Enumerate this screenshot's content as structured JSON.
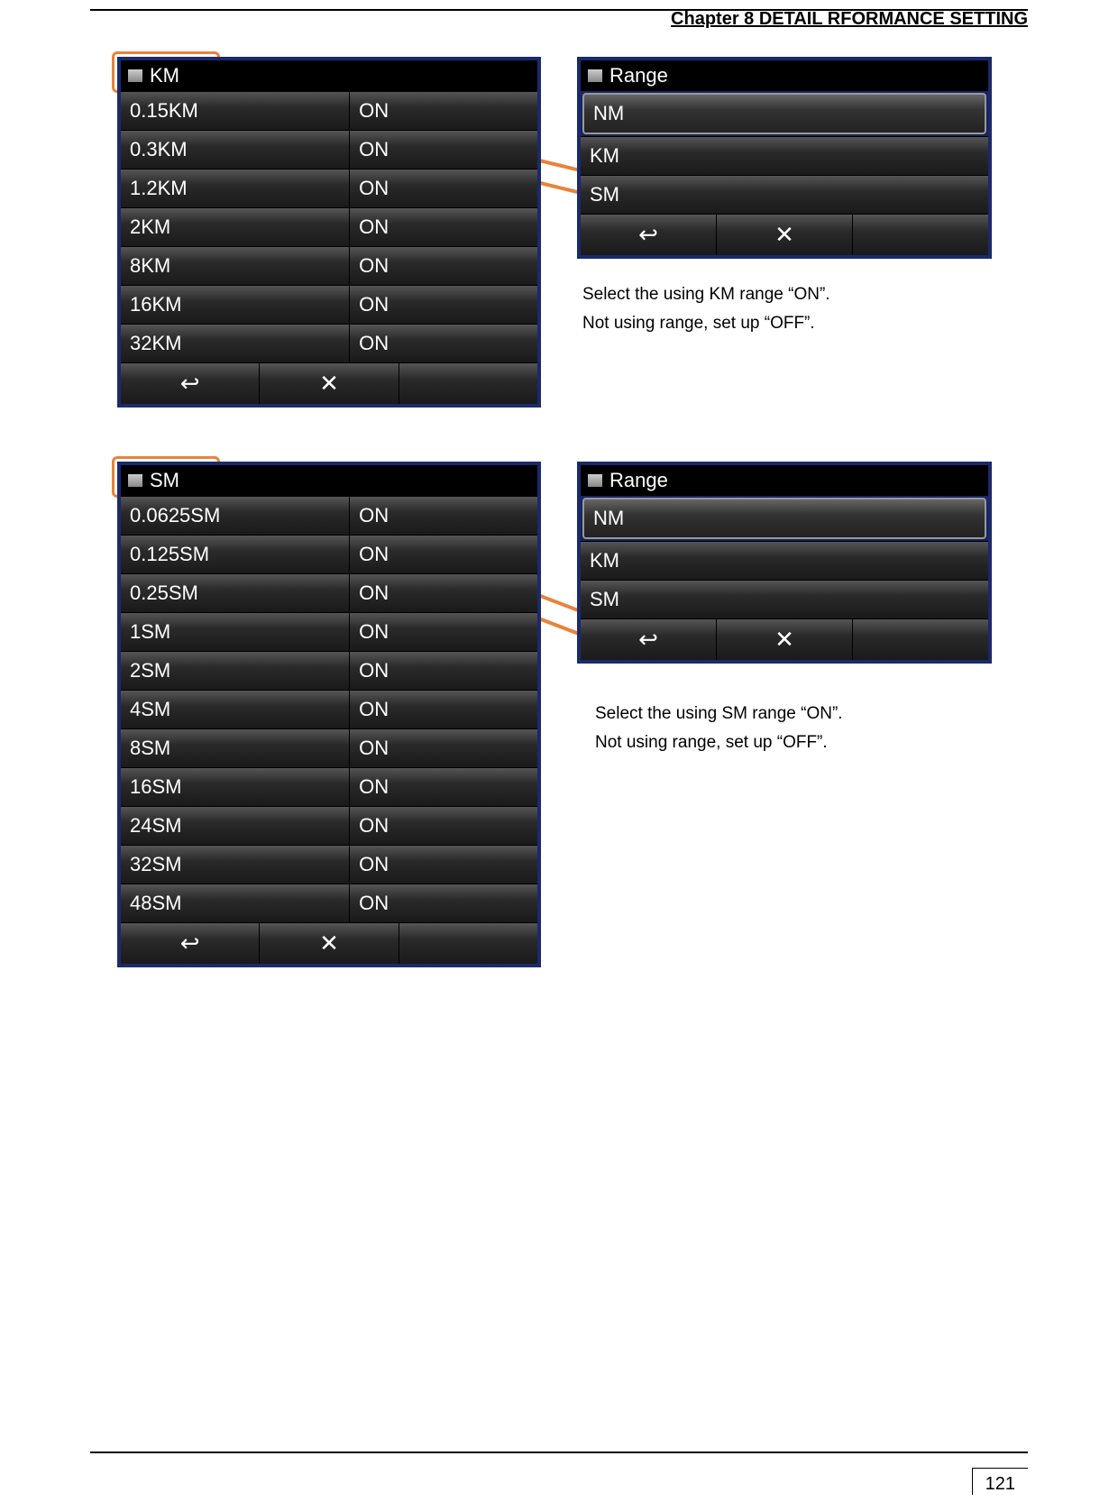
{
  "header": {
    "chapter": "Chapter 8    DETAIL RFORMANCE SETTING"
  },
  "footer": {
    "page_number": "121"
  },
  "section1": {
    "left_panel": {
      "title": "KM",
      "rows": [
        {
          "label": "0.15KM",
          "value": "ON"
        },
        {
          "label": "0.3KM",
          "value": "ON"
        },
        {
          "label": "1.2KM",
          "value": "ON"
        },
        {
          "label": "2KM",
          "value": "ON"
        },
        {
          "label": "8KM",
          "value": "ON"
        },
        {
          "label": "16KM",
          "value": "ON"
        },
        {
          "label": "32KM",
          "value": "ON"
        }
      ]
    },
    "right_panel": {
      "title": "Range",
      "items": [
        {
          "label": "NM",
          "selected": true
        },
        {
          "label": "KM",
          "selected": false
        },
        {
          "label": "SM",
          "selected": false
        }
      ]
    },
    "desc_line1": "Select the using KM range “ON”.",
    "desc_line2": "Not using range, set up “OFF”."
  },
  "section2": {
    "left_panel": {
      "title": "SM",
      "rows": [
        {
          "label": "0.0625SM",
          "value": "ON"
        },
        {
          "label": "0.125SM",
          "value": "ON"
        },
        {
          "label": "0.25SM",
          "value": "ON"
        },
        {
          "label": "1SM",
          "value": "ON"
        },
        {
          "label": "2SM",
          "value": "ON"
        },
        {
          "label": "4SM",
          "value": "ON"
        },
        {
          "label": "8SM",
          "value": "ON"
        },
        {
          "label": "16SM",
          "value": "ON"
        },
        {
          "label": "24SM",
          "value": "ON"
        },
        {
          "label": "32SM",
          "value": "ON"
        },
        {
          "label": "48SM",
          "value": "ON"
        }
      ]
    },
    "right_panel": {
      "title": "Range",
      "items": [
        {
          "label": "NM",
          "selected": true
        },
        {
          "label": "KM",
          "selected": false
        },
        {
          "label": "SM",
          "selected": false
        }
      ]
    },
    "desc_line1": "Select the using SM range “ON”.",
    "desc_line2": "Not using range, set up “OFF”."
  },
  "icons": {
    "back": "↩",
    "close": "✕"
  }
}
